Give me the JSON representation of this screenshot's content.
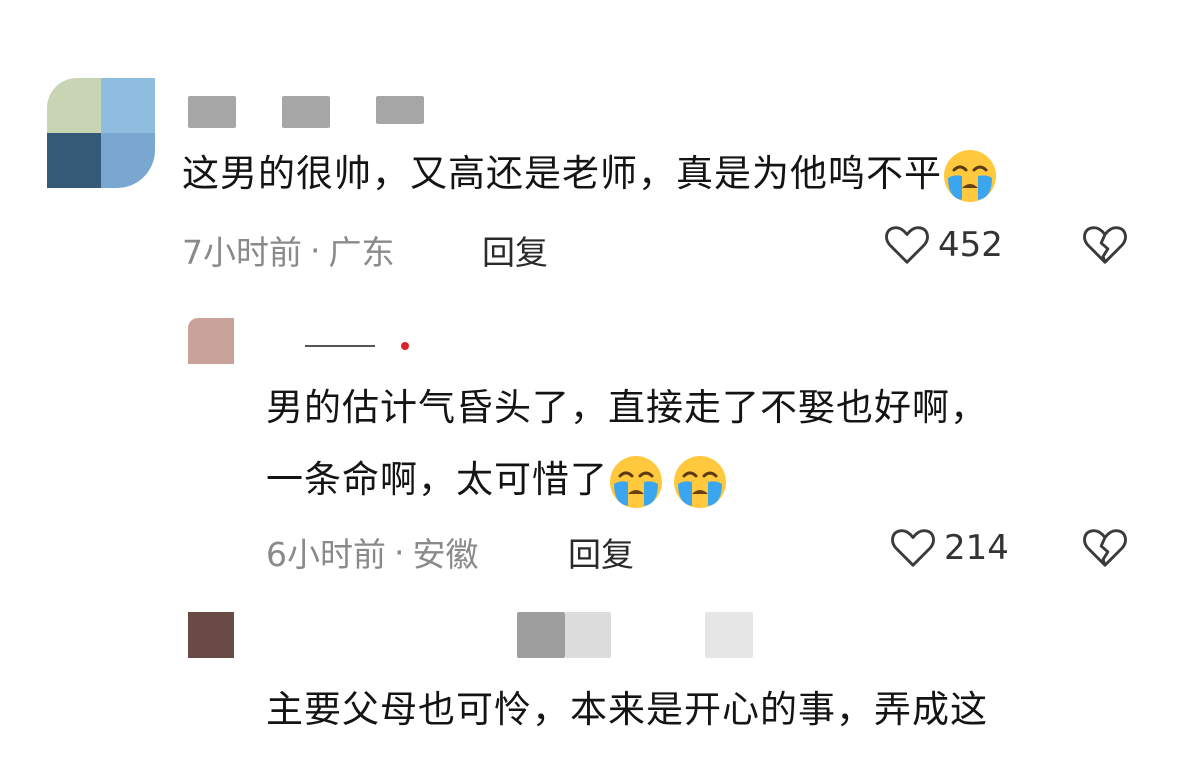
{
  "comments": [
    {
      "text": "这男的很帅，又高还是老师，真是为他鸣不平",
      "time": "7小时前",
      "location": "广东",
      "reply_label": "回复",
      "like_count": "452"
    },
    {
      "line1": "男的估计气昏头了，直接走了不娶也好啊，",
      "line2": "一条命啊，太可惜了",
      "time": "6小时前",
      "location": "安徽",
      "reply_label": "回复",
      "like_count": "214"
    },
    {
      "text": "主要父母也可怜，本来是开心的事，弄成这"
    }
  ],
  "meta_separator": "·",
  "icons": {
    "like": "heart-outline-icon",
    "dislike": "broken-heart-icon",
    "emoji": "loudly-crying-face-emoji"
  },
  "colors": {
    "text": "#141414",
    "meta": "#8a8a8a",
    "emoji_face": "#ffc83d",
    "emoji_tears": "#3aa6f0"
  }
}
